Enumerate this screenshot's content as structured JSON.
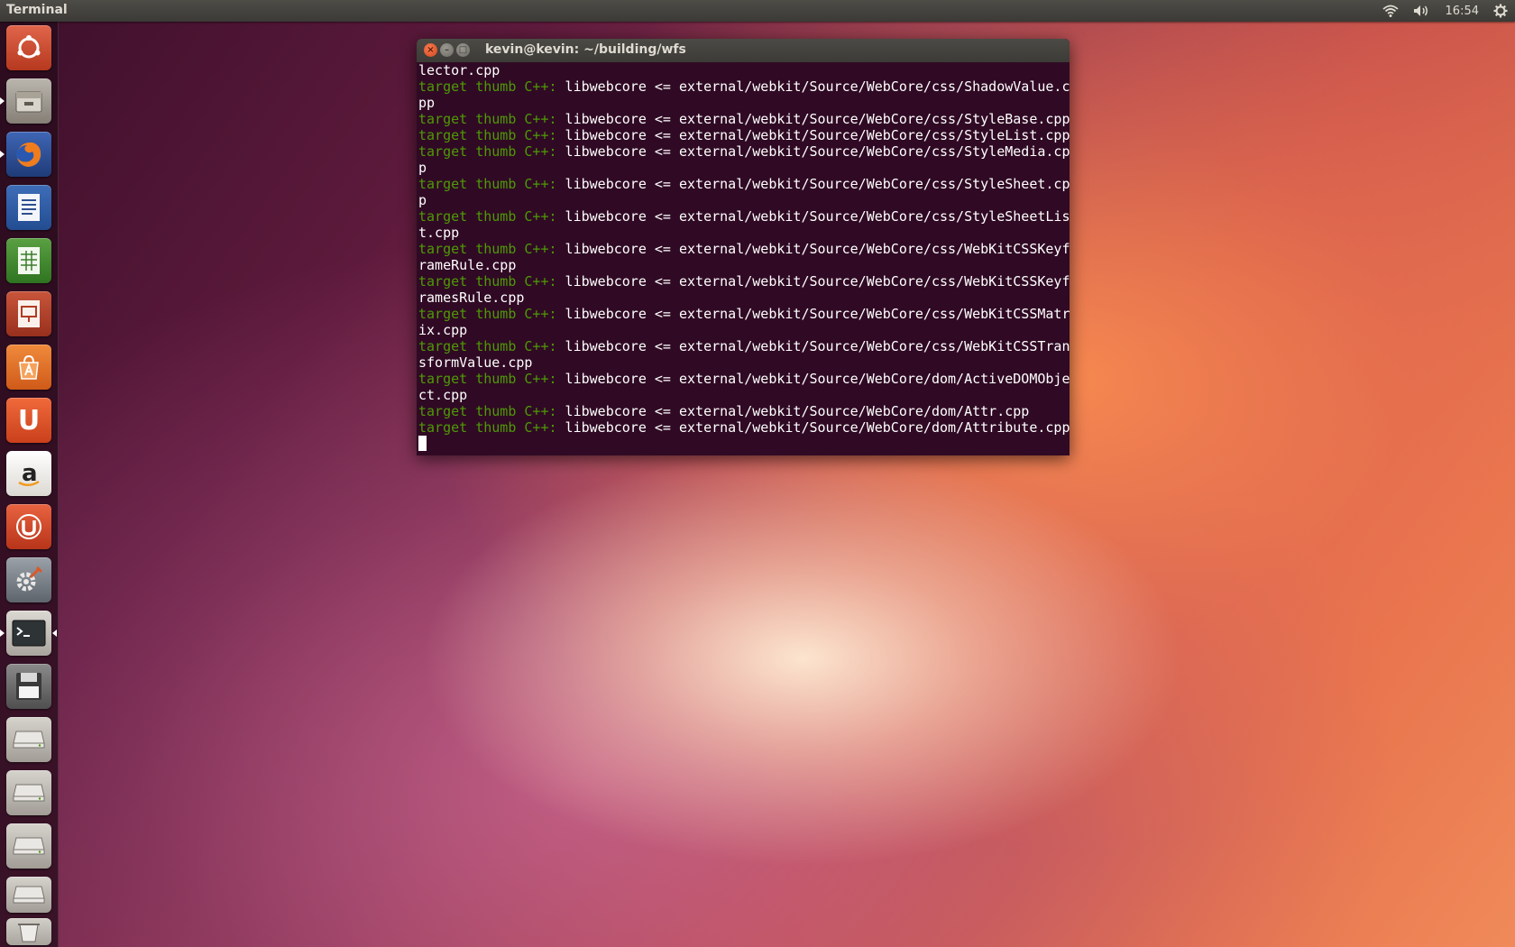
{
  "top_panel": {
    "app_title": "Terminal",
    "clock": "16:54",
    "indicators": [
      "wifi-icon",
      "volume-icon",
      "gear-icon"
    ]
  },
  "launcher": {
    "items": [
      {
        "name": "dash-home-icon",
        "color": "#c9482f"
      },
      {
        "name": "files-icon",
        "color": "#8a857c"
      },
      {
        "name": "firefox-icon",
        "color": "#2b4e8f"
      },
      {
        "name": "writer-icon",
        "color": "#cfd6e6"
      },
      {
        "name": "calc-icon",
        "color": "#d8e6c8"
      },
      {
        "name": "impress-icon",
        "color": "#ead8cc"
      },
      {
        "name": "software-center-icon",
        "color": "#e2712e"
      },
      {
        "name": "ubuntu-one-icon",
        "color": "#e1572b"
      },
      {
        "name": "amazon-icon",
        "color": "#f2f0ec"
      },
      {
        "name": "ubuntu-one-music-icon",
        "color": "#db4c2b"
      },
      {
        "name": "system-settings-icon",
        "color": "#7b7f86"
      },
      {
        "name": "terminal-icon",
        "color": "#2e3436"
      },
      {
        "name": "floppy-icon",
        "color": "#6b6b6b"
      },
      {
        "name": "drive-icon",
        "color": "#bdbbb6"
      },
      {
        "name": "drive-icon",
        "color": "#bdbbb6"
      },
      {
        "name": "drive-icon",
        "color": "#bdbbb6"
      },
      {
        "name": "trash-icon",
        "color": "#c9c7c2"
      }
    ]
  },
  "terminal": {
    "title": "kevin@kevin: ~/building/wfs",
    "prefix": "target thumb C++:",
    "lines": [
      {
        "green": "",
        "text": "lector.cpp"
      },
      {
        "green": "target thumb C++:",
        "text": " libwebcore <= external/webkit/Source/WebCore/css/ShadowValue.c"
      },
      {
        "green": "",
        "text": "pp"
      },
      {
        "green": "target thumb C++:",
        "text": " libwebcore <= external/webkit/Source/WebCore/css/StyleBase.cpp"
      },
      {
        "green": "target thumb C++:",
        "text": " libwebcore <= external/webkit/Source/WebCore/css/StyleList.cpp"
      },
      {
        "green": "target thumb C++:",
        "text": " libwebcore <= external/webkit/Source/WebCore/css/StyleMedia.cp"
      },
      {
        "green": "",
        "text": "p"
      },
      {
        "green": "target thumb C++:",
        "text": " libwebcore <= external/webkit/Source/WebCore/css/StyleSheet.cp"
      },
      {
        "green": "",
        "text": "p"
      },
      {
        "green": "target thumb C++:",
        "text": " libwebcore <= external/webkit/Source/WebCore/css/StyleSheetLis"
      },
      {
        "green": "",
        "text": "t.cpp"
      },
      {
        "green": "target thumb C++:",
        "text": " libwebcore <= external/webkit/Source/WebCore/css/WebKitCSSKeyf"
      },
      {
        "green": "",
        "text": "rameRule.cpp"
      },
      {
        "green": "target thumb C++:",
        "text": " libwebcore <= external/webkit/Source/WebCore/css/WebKitCSSKeyf"
      },
      {
        "green": "",
        "text": "ramesRule.cpp"
      },
      {
        "green": "target thumb C++:",
        "text": " libwebcore <= external/webkit/Source/WebCore/css/WebKitCSSMatr"
      },
      {
        "green": "",
        "text": "ix.cpp"
      },
      {
        "green": "target thumb C++:",
        "text": " libwebcore <= external/webkit/Source/WebCore/css/WebKitCSSTran"
      },
      {
        "green": "",
        "text": "sformValue.cpp"
      },
      {
        "green": "target thumb C++:",
        "text": " libwebcore <= external/webkit/Source/WebCore/dom/ActiveDOMObje"
      },
      {
        "green": "",
        "text": "ct.cpp"
      },
      {
        "green": "target thumb C++:",
        "text": " libwebcore <= external/webkit/Source/WebCore/dom/Attr.cpp"
      },
      {
        "green": "target thumb C++:",
        "text": " libwebcore <= external/webkit/Source/WebCore/dom/Attribute.cpp"
      }
    ]
  }
}
